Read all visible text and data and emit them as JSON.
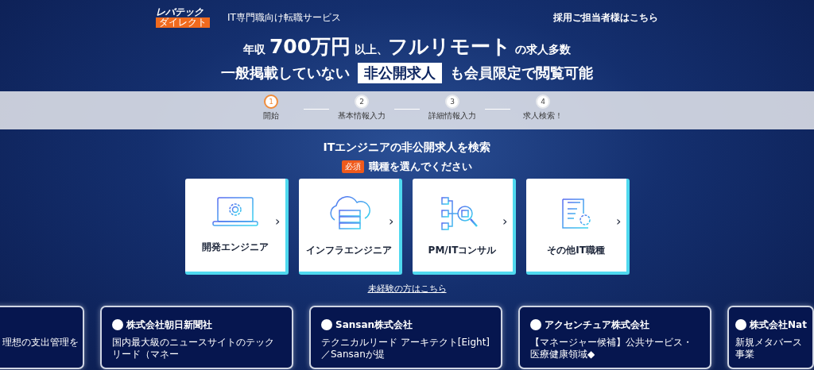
{
  "header": {
    "logo": {
      "name": "レバテック",
      "sub": "ダイレクト"
    },
    "tagline": "IT専門職向け転職サービス",
    "recruiter_link": "採用ご担当者様はこちら"
  },
  "hero": {
    "line1": "年収 **700万円** 以上、**フルリモート** の求人多数",
    "line2_before": "一般掲載していない",
    "line2_highlight": "非公開求人",
    "line2_after": "も会員限定で閲覧可能"
  },
  "steps": [
    {
      "number": "1",
      "label": "開始",
      "selected": true
    },
    {
      "number": "2",
      "label": "基本情報入力",
      "selected": false
    },
    {
      "number": "3",
      "label": "詳細情報入力",
      "selected": false
    },
    {
      "number": "4",
      "label": "求人検索！",
      "selected": false
    }
  ],
  "search": {
    "title": "ITエンジニアの非公開求人を検索",
    "required_badge": "必須",
    "prompt": "職種を選んでください"
  },
  "job_types": [
    {
      "kind": "laptop",
      "label": "開発エンジニア",
      "chevron": "›"
    },
    {
      "kind": "cloud",
      "label": "インフラエンジニア",
      "chevron": "›"
    },
    {
      "kind": "diagram",
      "label": "PM/ITコンサル",
      "chevron": "›"
    },
    {
      "kind": "document",
      "label": "その他IT職種",
      "chevron": "›"
    }
  ],
  "inexperienced_link": "未経験の方はこちら",
  "companies": [
    {
      "description": "理想の支出管理を"
    },
    {
      "name": "株式会社朝日新聞社",
      "description": "国内最大級のニュースサイトのテックリード（マネー"
    },
    {
      "name": "Sansan株式会社",
      "description": "テクニカルリード アーキテクト[Eight]／Sansanが提"
    },
    {
      "name": "アクセンチュア株式会社",
      "description": "【マネージャー候補】公共サービス・医療健康領域◆"
    },
    {
      "name": "株式会社Nat",
      "description": "新規メタバース事業"
    }
  ]
}
